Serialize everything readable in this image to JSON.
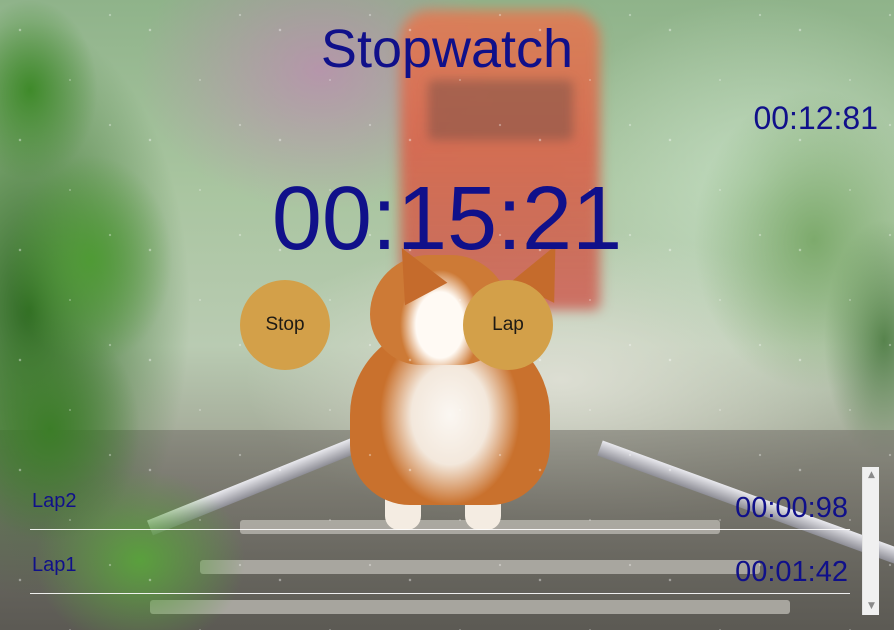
{
  "app": {
    "title": "Stopwatch",
    "current_time": "00:15:21",
    "last_lap_time": "00:12:81"
  },
  "controls": {
    "stop_label": "Stop",
    "lap_label": "Lap"
  },
  "laps": [
    {
      "name": "Lap2",
      "time": "00:00:98"
    },
    {
      "name": "Lap1",
      "time": "00:01:42"
    }
  ],
  "scrollbar": {
    "up_icon": "▲",
    "down_icon": "▼"
  },
  "background": {
    "description_icon": "corgi-photo"
  },
  "colors": {
    "text": "#10108a",
    "button": "#d3a049"
  }
}
